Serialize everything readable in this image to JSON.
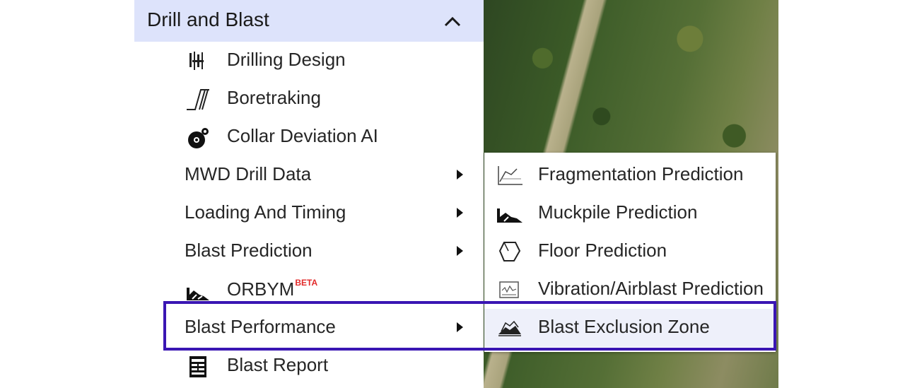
{
  "menu": {
    "header": {
      "title": "Drill and Blast",
      "collapse_icon": "chevron-up-icon"
    },
    "items": [
      {
        "label": "Drilling Design",
        "icon": "drilling-design-icon"
      },
      {
        "label": "Boretraking",
        "icon": "boretracking-icon"
      },
      {
        "label": "Collar Deviation AI",
        "icon": "collar-deviation-icon"
      },
      {
        "label": "MWD Drill Data",
        "has_submenu": true
      },
      {
        "label": "Loading And Timing",
        "has_submenu": true
      },
      {
        "label": "Blast Prediction",
        "has_submenu": true
      },
      {
        "label": "ORBYM",
        "badge": "BETA",
        "icon": "orbym-icon"
      },
      {
        "label": "Blast Performance",
        "has_submenu": true
      },
      {
        "label": "Blast Report",
        "icon": "report-icon"
      }
    ]
  },
  "submenu": {
    "items": [
      {
        "label": "Fragmentation Prediction",
        "icon": "fragmentation-icon"
      },
      {
        "label": "Muckpile Prediction",
        "icon": "muckpile-icon"
      },
      {
        "label": "Floor Prediction",
        "icon": "floor-icon"
      },
      {
        "label": "Vibration/Airblast Prediction",
        "icon": "vibration-icon"
      },
      {
        "label": "Blast Exclusion Zone",
        "icon": "exclusion-zone-icon",
        "selected": true
      }
    ]
  },
  "colors": {
    "header_bg": "#dde3fb",
    "highlight_border": "#3a16b3",
    "beta_badge": "#e22a2a",
    "selected_bg": "#eef0fa"
  }
}
